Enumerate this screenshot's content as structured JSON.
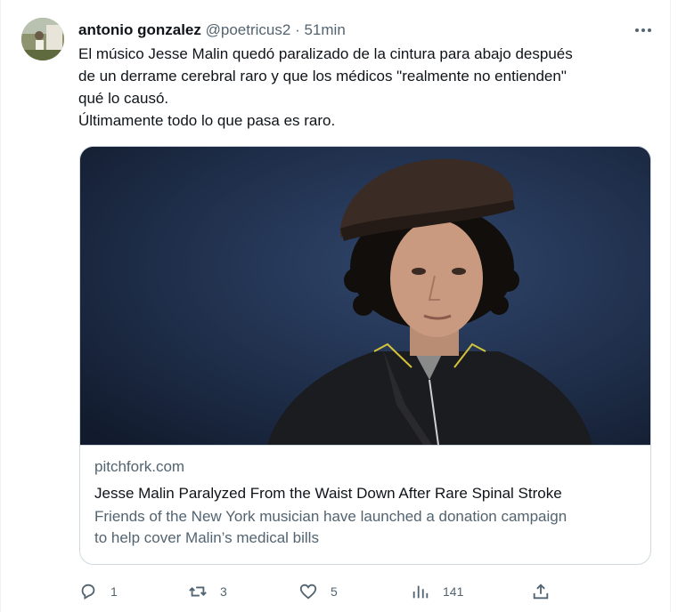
{
  "tweet": {
    "author_name": "antonio gonzalez",
    "author_handle": "@poetricus2",
    "separator": "·",
    "time": "51min",
    "more_icon": "more-horizontal-icon",
    "text_lines": [
      "El músico Jesse Malin quedó paralizado de la cintura para abajo después",
      "de un derrame cerebral raro y que los médicos \"realmente no entienden\"",
      "qué lo causó.",
      "Últimamente todo lo que pasa es raro."
    ]
  },
  "card": {
    "domain": "pitchfork.com",
    "title": "Jesse Malin Paralyzed From the Waist Down After Rare Spinal Stroke",
    "description_lines": [
      "Friends of the New York musician have launched a donation campaign",
      "to help cover Malin’s medical bills"
    ]
  },
  "actions": {
    "replies": "1",
    "retweets": "3",
    "likes": "5",
    "views": "141"
  },
  "colors": {
    "text": "#0f1419",
    "secondary": "#536471",
    "border": "#cfd9de"
  }
}
